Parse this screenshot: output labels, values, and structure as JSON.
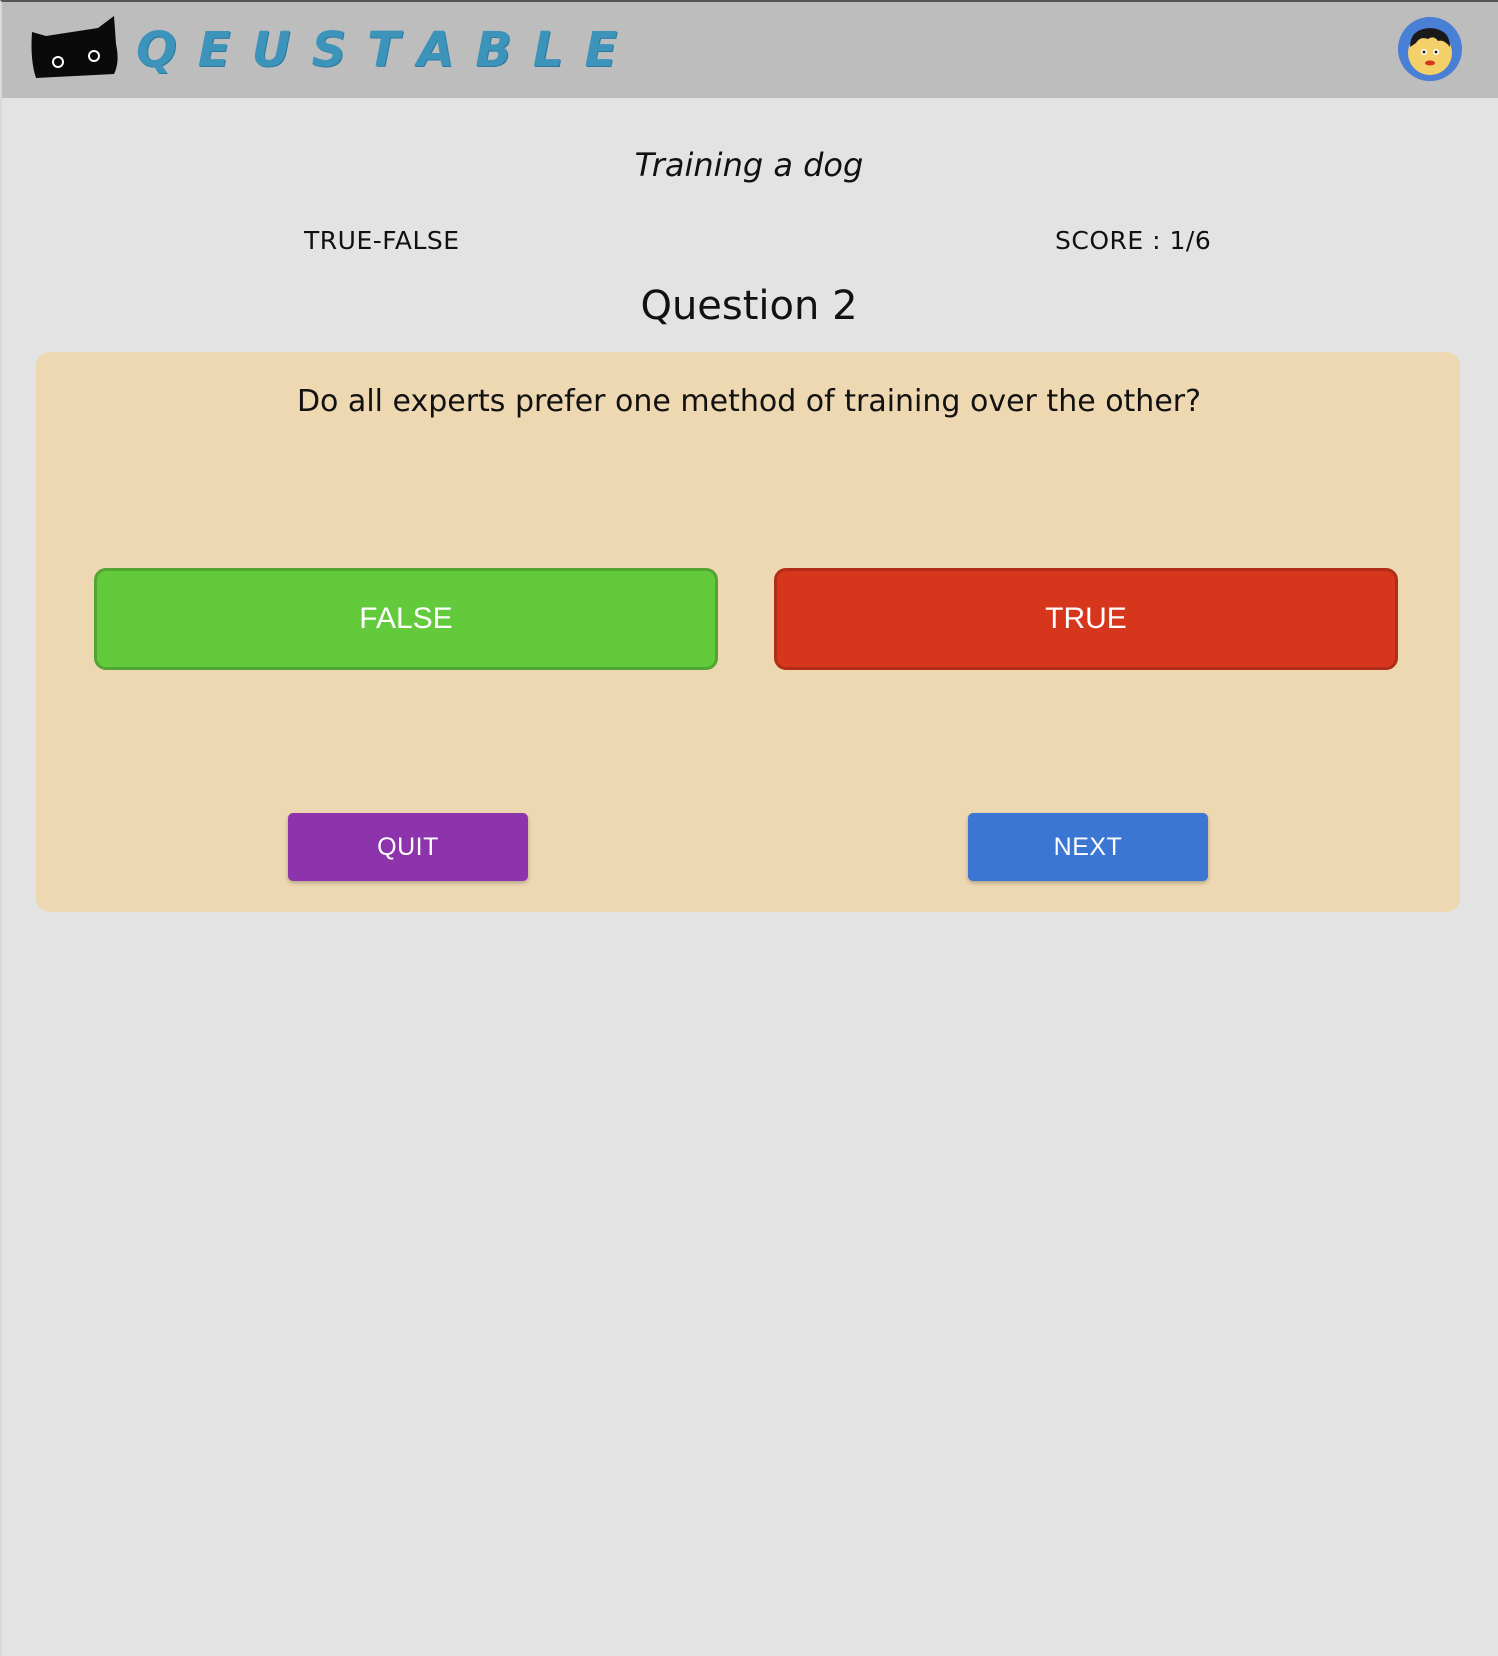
{
  "app": {
    "logo_text": "QEUSTABLE",
    "logo_icon": "black-cat-icon",
    "avatar_icon": "user-avatar-icon"
  },
  "quiz": {
    "topic": "Training a dog",
    "type_label": "TRUE-FALSE",
    "score_label": "SCORE : 1/6",
    "question_number_label": "Question 2",
    "question_text": "Do all experts prefer one method of training over the other?"
  },
  "answers": {
    "false_label": "FALSE",
    "true_label": "TRUE"
  },
  "actions": {
    "quit_label": "QUIT",
    "next_label": "NEXT"
  },
  "colors": {
    "navbar_bg": "#bdbdbd",
    "page_bg": "#e4e3e4",
    "card_bg": "#edd8b2",
    "logo_text": "#3d94bb",
    "false_button": "#63cb3b",
    "true_button": "#d6371c",
    "quit_button": "#8d33ab",
    "next_button": "#3a76d2",
    "avatar_ring": "#4a7fd6"
  }
}
